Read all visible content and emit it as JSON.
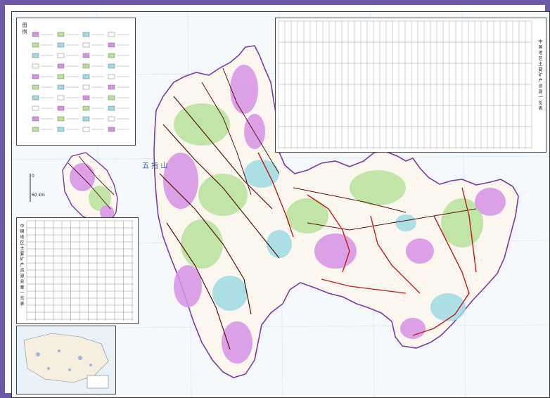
{
  "map": {
    "title": "中 国 地 区 主 要 矿 产 资 源 总 量 一 览 表",
    "scale_label": "0",
    "scale_unit": "60 km",
    "region_label": "五 指 山",
    "legend_title": "图 例",
    "lookup_title": "中 国 地 区 主 要 矿 产 资 源 一 览 表",
    "colors": {
      "border": "#6a5aa8",
      "magenta": "#d792e6",
      "green": "#b8e29a",
      "cyan": "#9edbe4",
      "fault_red": "#c01a1a",
      "fault_dark": "#5a1010",
      "land": "#fbf7ef"
    }
  }
}
